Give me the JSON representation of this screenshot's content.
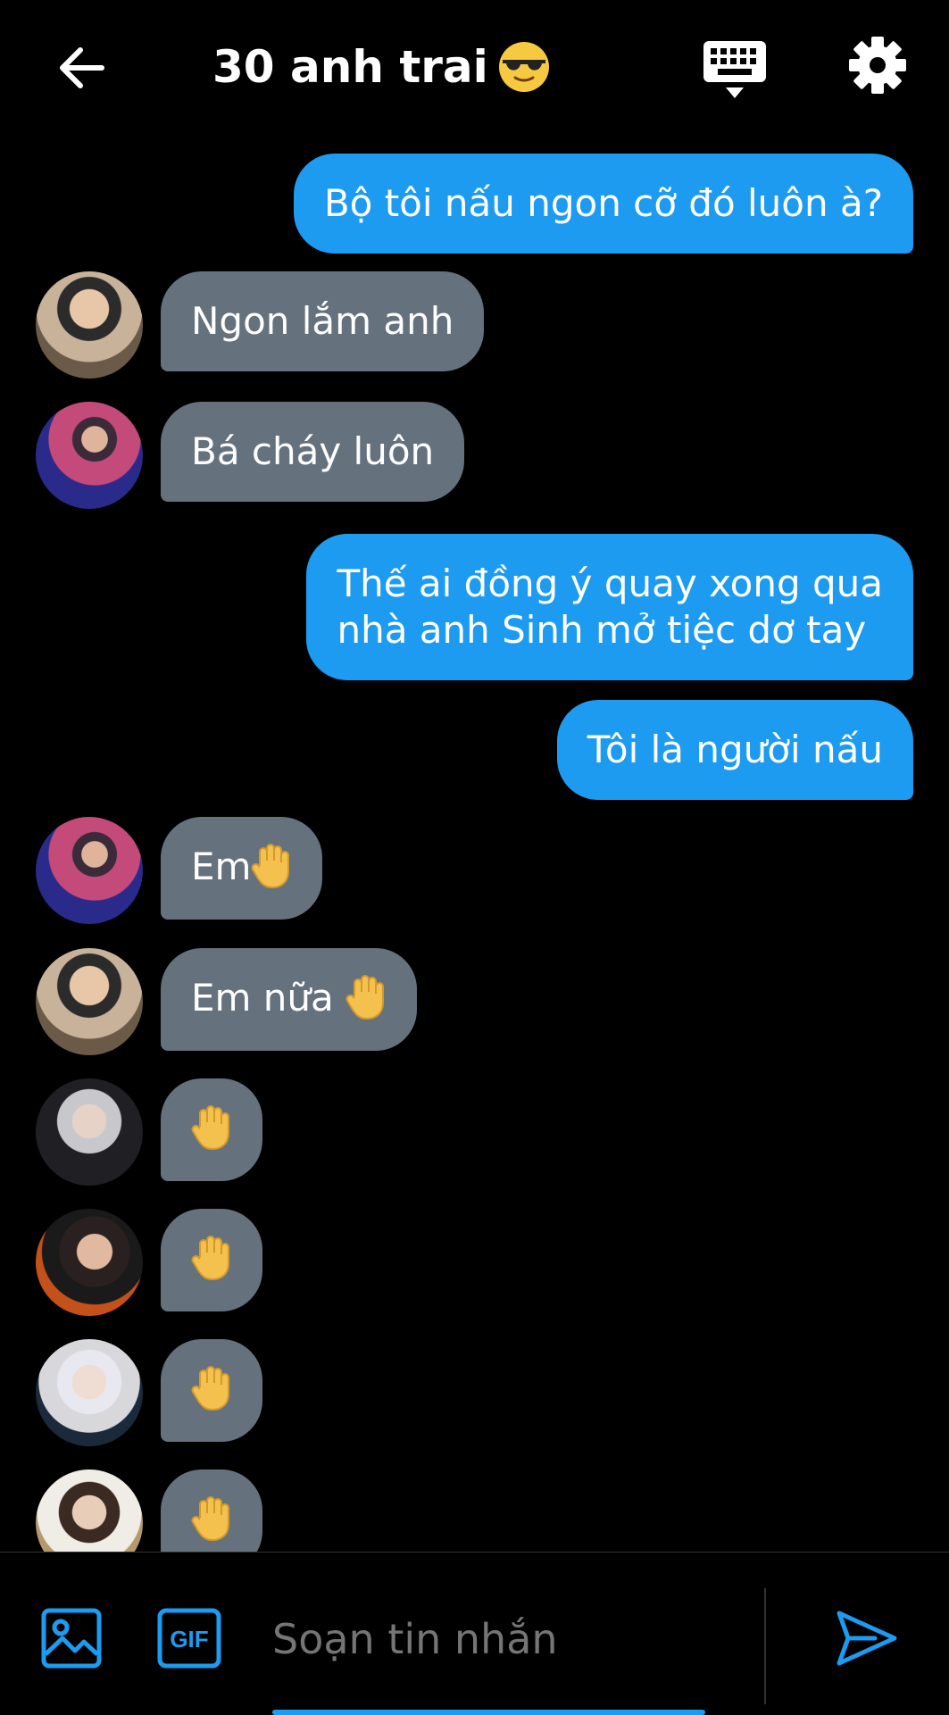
{
  "header": {
    "title": "30 anh trai",
    "back_icon": "arrow-left-icon",
    "keyboard_icon": "keyboard-icon",
    "settings_icon": "gear-icon"
  },
  "messages": [
    {
      "side": "out",
      "text": "Bộ tôi nấu ngon cỡ đó luôn à?"
    },
    {
      "side": "in",
      "text": "Ngon lắm anh"
    },
    {
      "side": "in",
      "text": "Bá cháy luôn"
    },
    {
      "side": "out",
      "line1": "Thế ai đồng ý quay xong qua",
      "line2": "nhà anh Sinh mở tiệc dơ tay"
    },
    {
      "side": "out",
      "text": "Tôi là người nấu"
    },
    {
      "side": "in",
      "text": "Em"
    },
    {
      "side": "in",
      "text": "Em nữa"
    },
    {
      "side": "in",
      "text": ""
    },
    {
      "side": "in",
      "text": ""
    },
    {
      "side": "in",
      "text": ""
    },
    {
      "side": "in",
      "text": ""
    }
  ],
  "composer": {
    "placeholder": "Soạn tin nhắn",
    "gif_label": "GIF"
  },
  "colors": {
    "outgoing": "#1d9bf0",
    "incoming": "#66717e",
    "background": "#000000",
    "accent": "#1d9bf0"
  }
}
